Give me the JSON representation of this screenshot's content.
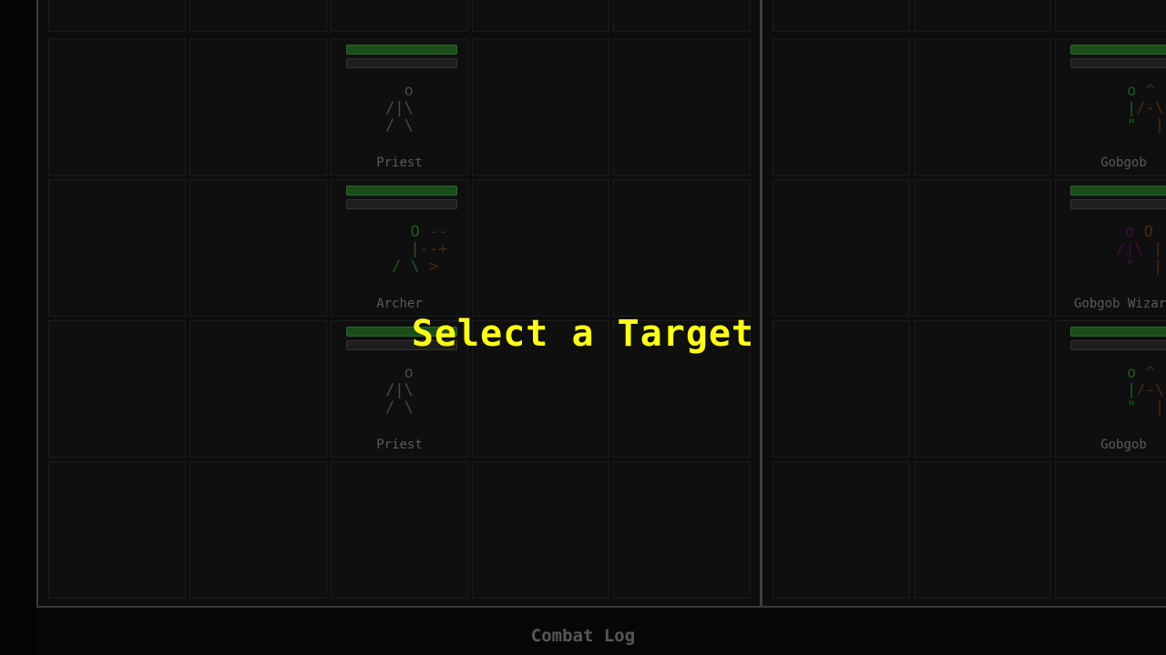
{
  "overlay": {
    "prompt": "Select a Target"
  },
  "footer": {
    "combat_log_label": "Combat Log"
  },
  "party": {
    "units": [
      {
        "name": "Priest",
        "row": 1,
        "col": 2,
        "hp_fraction": 1.0
      },
      {
        "name": "Archer",
        "row": 2,
        "col": 2,
        "hp_fraction": 1.0
      },
      {
        "name": "Priest",
        "row": 3,
        "col": 2,
        "hp_fraction": 1.0
      }
    ]
  },
  "enemies": {
    "units": [
      {
        "name": "Gobgob",
        "row": 1,
        "col": 2,
        "hp_fraction": 1.0
      },
      {
        "name": "Gobgob Wizard",
        "row": 2,
        "col": 2,
        "hp_fraction": 1.0
      },
      {
        "name": "Gobgob",
        "row": 3,
        "col": 2,
        "hp_fraction": 1.0
      }
    ]
  },
  "colors": {
    "prompt": "#ffff1a",
    "hp_bar": "#1a4d1a",
    "background": "#0d0d0d"
  }
}
